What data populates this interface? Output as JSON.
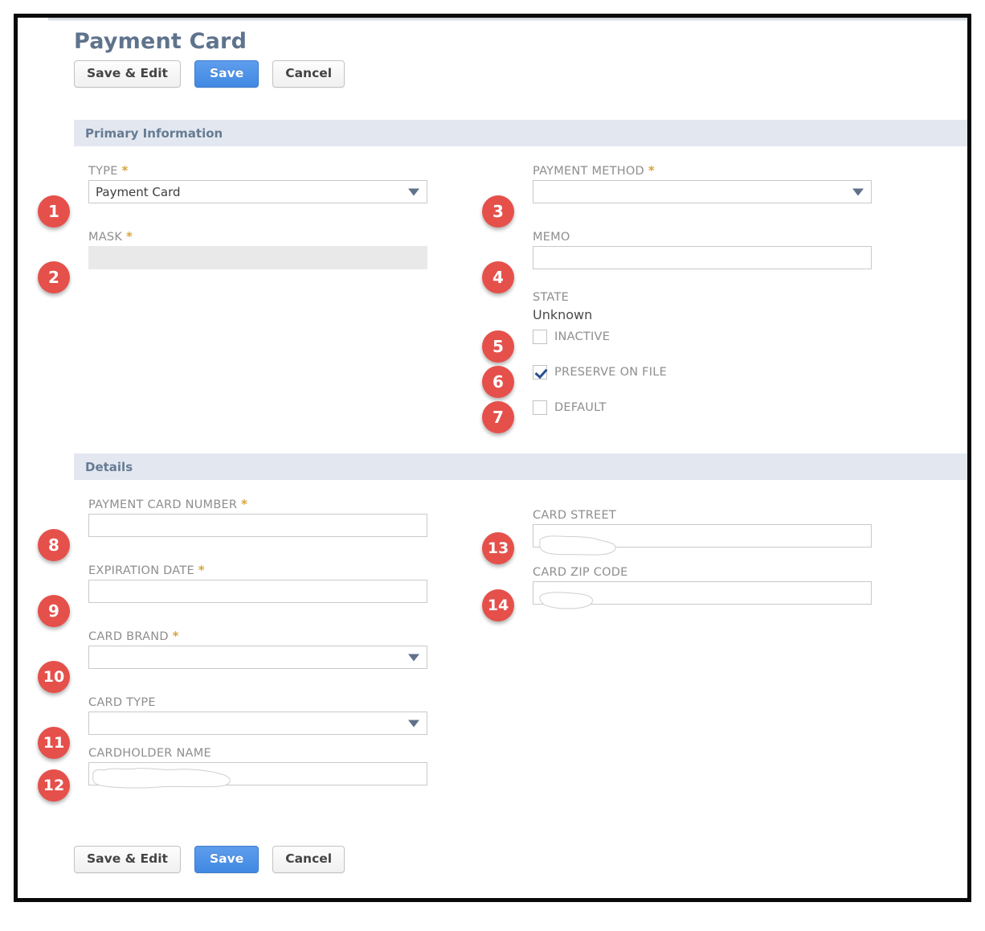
{
  "page": {
    "title": "Payment Card"
  },
  "toolbar_top": {
    "save_edit_label": "Save & Edit",
    "save_label": "Save",
    "cancel_label": "Cancel"
  },
  "toolbar_bottom": {
    "save_edit_label": "Save & Edit",
    "save_label": "Save",
    "cancel_label": "Cancel"
  },
  "sections": {
    "primary": {
      "title": "Primary Information"
    },
    "details": {
      "title": "Details"
    }
  },
  "fields": {
    "type": {
      "label": "TYPE",
      "required": "*",
      "value": "Payment Card",
      "badge": "1"
    },
    "mask": {
      "label": "MASK",
      "required": "*",
      "value": "",
      "badge": "2"
    },
    "payment_method": {
      "label": "PAYMENT METHOD",
      "required": "*",
      "value": "",
      "badge": "3"
    },
    "memo": {
      "label": "MEMO",
      "required": "",
      "value": "",
      "badge": "4"
    },
    "payment_card_number": {
      "label": "PAYMENT CARD NUMBER",
      "required": "*",
      "value": "",
      "badge": "8"
    },
    "expiration_date": {
      "label": "EXPIRATION DATE",
      "required": "*",
      "value": "",
      "badge": "9"
    },
    "card_brand": {
      "label": "CARD BRAND",
      "required": "*",
      "value": "",
      "badge": "10"
    },
    "card_type": {
      "label": "CARD TYPE",
      "required": "",
      "value": "",
      "badge": "11"
    },
    "cardholder_name": {
      "label": "CARDHOLDER NAME",
      "required": "",
      "value": "",
      "badge": "12"
    },
    "card_street": {
      "label": "CARD STREET",
      "required": "",
      "value": "",
      "badge": "13"
    },
    "card_zip_code": {
      "label": "CARD ZIP CODE",
      "required": "",
      "value": "",
      "badge": "14"
    }
  },
  "state": {
    "label": "STATE",
    "value": "Unknown"
  },
  "checkboxes": {
    "inactive": {
      "label": "INACTIVE",
      "checked": false,
      "badge": "5"
    },
    "preserve_on_file": {
      "label": "PRESERVE ON FILE",
      "checked": true,
      "badge": "6"
    },
    "default": {
      "label": "DEFAULT",
      "checked": false,
      "badge": "7"
    }
  },
  "colors": {
    "badge_red": "#e5504b",
    "primary_blue": "#4189e3",
    "section_bar": "#e3e8f0",
    "title_slate": "#5f738d",
    "label_gray": "#8e8e8e",
    "required_gold": "#d8a33c",
    "caret_slate": "#60718a",
    "check_navy": "#28508f"
  }
}
